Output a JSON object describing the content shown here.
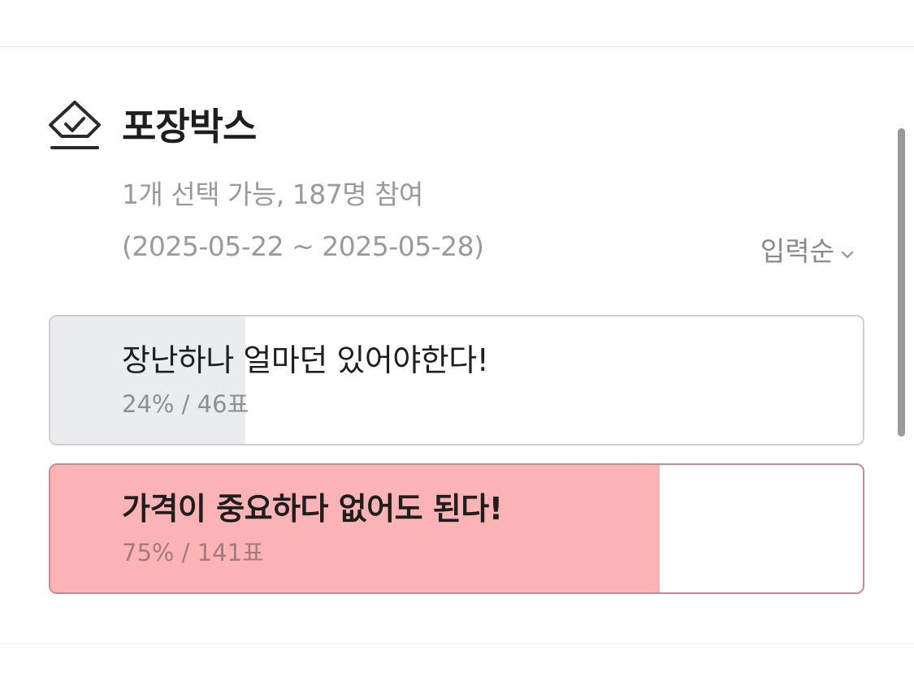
{
  "poll": {
    "title": "포장박스",
    "meta_line_1": "1개 선택 가능, 187명 참여",
    "meta_line_2": "(2025-05-22 ~ 2025-05-28)",
    "sort_label": "입력순",
    "icon": "vote-check-icon",
    "options": [
      {
        "label": "장난하나 얼마던 있어야한다!",
        "stat": "24% / 46표",
        "percent": 24,
        "votes": 46,
        "selected": false
      },
      {
        "label": "가격이 중요하다 없어도 된다!",
        "stat": "75% / 141표",
        "percent": 75,
        "votes": 141,
        "selected": true
      }
    ]
  },
  "colors": {
    "fill_default": "#ebecee",
    "fill_selected": "#fbb3b5",
    "border": "#cfcfcf",
    "title": "#1e1e1e",
    "muted": "#9a9a9a"
  }
}
